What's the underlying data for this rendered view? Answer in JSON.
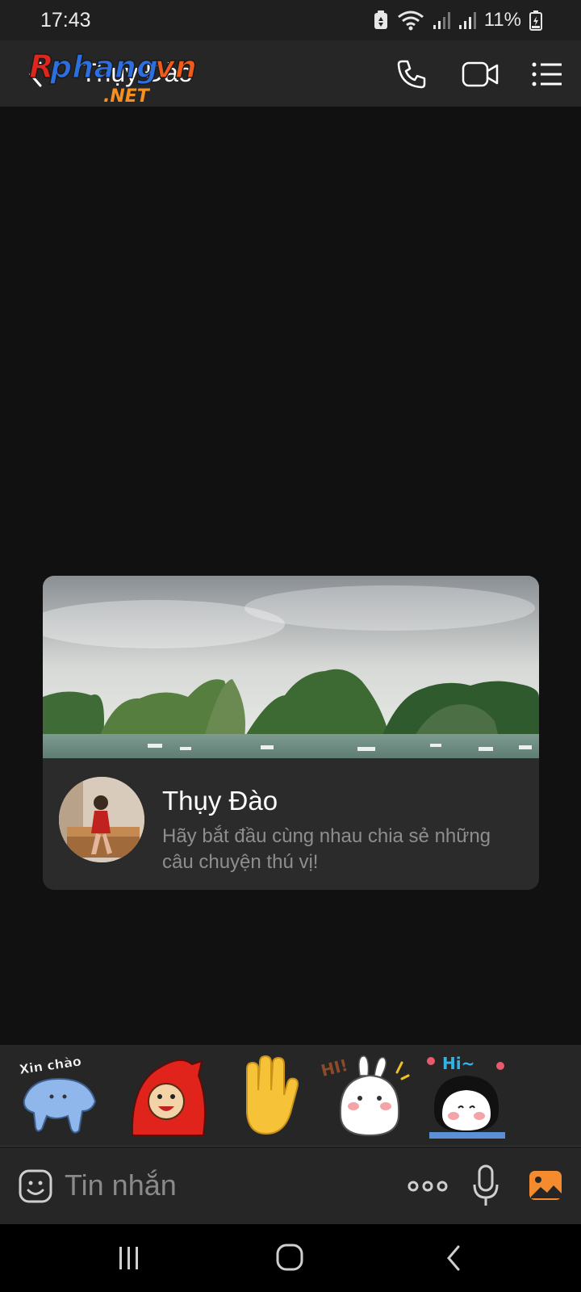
{
  "status": {
    "time": "17:43",
    "battery": "11%"
  },
  "header": {
    "title": "Thụy Đào",
    "watermark": "Rphangvn.NET",
    "icons": [
      "back-icon",
      "phone-icon",
      "video-icon",
      "menu-icon"
    ]
  },
  "card": {
    "name": "Thụy Đào",
    "intro": "Hãy bắt đầu cùng nhau chia sẻ những câu chuyện thú vị!"
  },
  "stickers": {
    "xin_chao_text": "Xin chào",
    "hi_text": "HI!",
    "hi2_text": "Hi~"
  },
  "composer": {
    "placeholder": "Tin nhắn"
  },
  "colors": {
    "accent": "#f58b2f",
    "background": "#111111",
    "bar": "#262626"
  }
}
